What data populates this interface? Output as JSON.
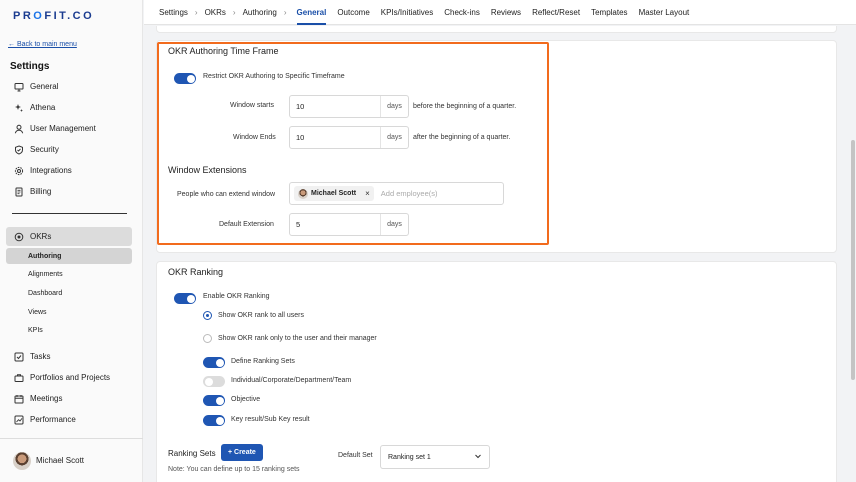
{
  "app": {
    "logo_text": "PR",
    "logo_o": "O",
    "logo_rest": "FIT.CO"
  },
  "sidebar": {
    "back_link": "← Back to main menu",
    "settings_heading": "Settings",
    "items": [
      {
        "label": "General",
        "icon": "monitor-icon"
      },
      {
        "label": "Athena",
        "icon": "sparkle-icon"
      },
      {
        "label": "User Management",
        "icon": "user-icon"
      },
      {
        "label": "Security",
        "icon": "shield-icon"
      },
      {
        "label": "Integrations",
        "icon": "gear-icon"
      },
      {
        "label": "Billing",
        "icon": "receipt-icon"
      }
    ],
    "okrs_label": "OKRs",
    "okr_subitems": [
      "Authoring",
      "Alignments",
      "Dashboard",
      "Views",
      "KPIs"
    ],
    "bottom_items": [
      {
        "label": "Tasks",
        "icon": "checkbox-icon"
      },
      {
        "label": "Portfolios and Projects",
        "icon": "briefcase-icon"
      },
      {
        "label": "Meetings",
        "icon": "calendar-icon"
      },
      {
        "label": "Performance",
        "icon": "chart-icon"
      }
    ],
    "user_name": "Michael Scott"
  },
  "topnav": {
    "crumbs": [
      "Settings",
      "OKRs",
      "Authoring"
    ],
    "tabs": [
      "General",
      "Outcome",
      "KPIs/Initiatives",
      "Check-ins",
      "Reviews",
      "Reflect/Reset",
      "Templates",
      "Master Layout"
    ],
    "active_tab": "General"
  },
  "timeframe": {
    "title": "OKR Authoring Time Frame",
    "restrict_label": "Restrict OKR Authoring to Specific Timeframe",
    "window_starts_label": "Window starts",
    "window_starts_value": "10",
    "window_starts_unit": "days",
    "window_starts_suffix": "before the beginning of a quarter.",
    "window_ends_label": "Window Ends",
    "window_ends_value": "10",
    "window_ends_unit": "days",
    "window_ends_suffix": "after the beginning of a quarter."
  },
  "extensions": {
    "title": "Window Extensions",
    "people_label": "People who can extend window",
    "chip_name": "Michael Scott",
    "chip_remove": "×",
    "add_placeholder": "Add employee(s)",
    "default_label": "Default Extension",
    "default_value": "5",
    "default_unit": "days"
  },
  "ranking": {
    "title": "OKR Ranking",
    "enable_label": "Enable OKR Ranking",
    "radio_all": "Show OKR rank to all users",
    "radio_manager": "Show OKR rank only to the user and their manager",
    "toggles": [
      {
        "label": "Define Ranking Sets",
        "on": true
      },
      {
        "label": "Individual/Corporate/Department/Team",
        "on": false
      },
      {
        "label": "Objective",
        "on": true
      },
      {
        "label": "Key result/Sub Key result",
        "on": true
      }
    ],
    "sets_label": "Ranking Sets",
    "create_label": "+ Create",
    "note": "Note: You can define up to 15 ranking sets",
    "default_set_label": "Default Set",
    "default_set_value": "Ranking set 1"
  }
}
